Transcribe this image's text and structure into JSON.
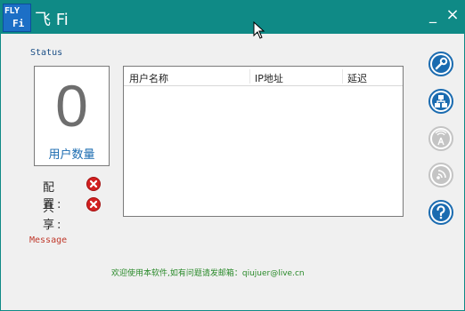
{
  "titlebar": {
    "app_title": "飞 Fi",
    "logo_text": "FLY",
    "logo_sub": "Fi",
    "minimize_label": "_",
    "close_label": "×"
  },
  "status": {
    "section_label": "Status",
    "user_count": "0",
    "user_count_caption": "用户数量",
    "config_label": "配置:",
    "share_label": "共享:",
    "config_state_icon": "error-x-icon",
    "share_state_icon": "error-x-icon"
  },
  "table": {
    "columns": [
      "用户名称",
      "IP地址",
      "延迟"
    ],
    "rows": []
  },
  "sidebar": {
    "buttons": [
      {
        "icon": "wrench-icon",
        "enabled": true
      },
      {
        "icon": "network-icon",
        "enabled": true
      },
      {
        "icon": "wifi-tower-icon",
        "enabled": false
      },
      {
        "icon": "signal-icon",
        "enabled": false
      },
      {
        "icon": "help-icon",
        "enabled": true
      }
    ]
  },
  "message": {
    "section_label": "Message",
    "footer_text": "欢迎使用本软件,如有问题请发邮箱：qiujuer@live.cn"
  },
  "colors": {
    "titlebar": "#0f8a86",
    "accent_blue": "#1a6bb0",
    "error_red": "#d22020",
    "disabled_gray": "#b8b8b8",
    "footer_green": "#2a8a2a"
  }
}
